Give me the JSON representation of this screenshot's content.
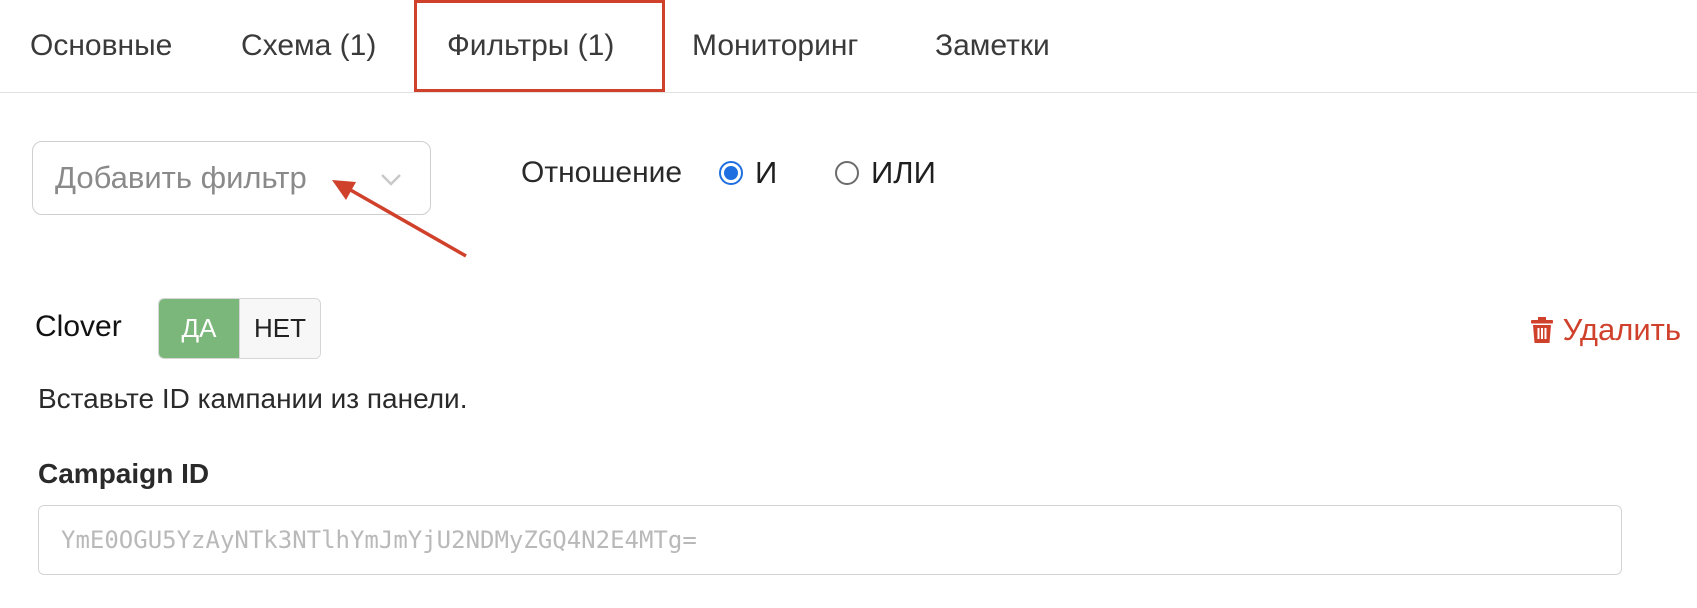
{
  "tabs": [
    {
      "label": "Основные",
      "active": false
    },
    {
      "label": "Схема (1)",
      "active": false
    },
    {
      "label": "Фильтры (1)",
      "active": true
    },
    {
      "label": "Мониторинг",
      "active": false
    },
    {
      "label": "Заметки",
      "active": false
    }
  ],
  "add_filter": {
    "placeholder": "Добавить фильтр",
    "icon": "chevron-down-icon"
  },
  "relation": {
    "label": "Отношение",
    "options": [
      {
        "label": "И",
        "checked": true
      },
      {
        "label": "ИЛИ",
        "checked": false
      }
    ]
  },
  "filter": {
    "name": "Clover",
    "toggle": {
      "yes": "ДА",
      "no": "НЕТ",
      "selected": "yes"
    },
    "delete_label": "Удалить",
    "delete_icon": "trash-icon",
    "hint": "Вставьте ID кампании из панели.",
    "field_label": "Campaign ID",
    "field_placeholder": "YmE0OGU5YzAyNTk3NTlhYmJmYjU2NDMyZGQ4N2E4MTg=",
    "field_value": ""
  },
  "colors": {
    "accent_red": "#d0412c",
    "radio_blue": "#1f6fe0",
    "toggle_green": "#7bb77a"
  }
}
